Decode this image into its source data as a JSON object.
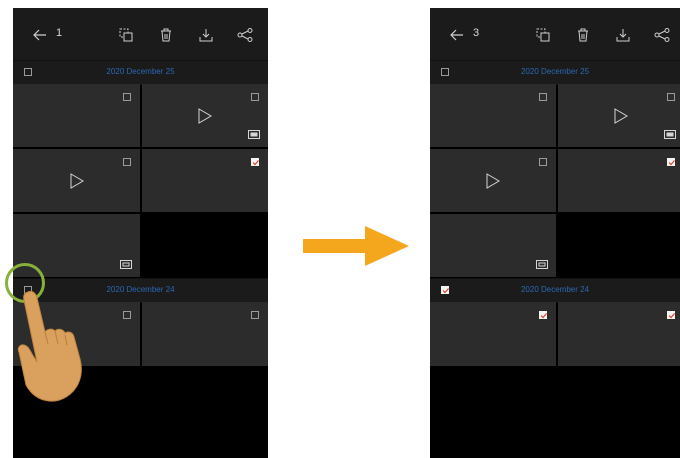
{
  "left": {
    "selected_count": "1",
    "group1_date": "2020 December 25",
    "group2_date": "2020 December 24",
    "group1_checked": false,
    "group2_checked": false
  },
  "right": {
    "selected_count": "3",
    "group1_date": "2020 December 25",
    "group2_date": "2020 December 24",
    "group1_checked": false,
    "group2_checked": true
  },
  "colors": {
    "topbar": "#1b1b1b",
    "tile": "#2c2c2c",
    "date_text": "#2a68b4",
    "arrow": "#f4a61d",
    "touch_ring": "#86b23b",
    "check_mark": "#e0452b"
  },
  "icons": {
    "back": "arrow-left-icon",
    "copy": "copy-icon",
    "delete": "trash-icon",
    "download": "download-icon",
    "share": "share-icon",
    "play": "play-icon",
    "video_badge": "video-badge-icon",
    "photo_badge": "photo-badge-icon"
  }
}
